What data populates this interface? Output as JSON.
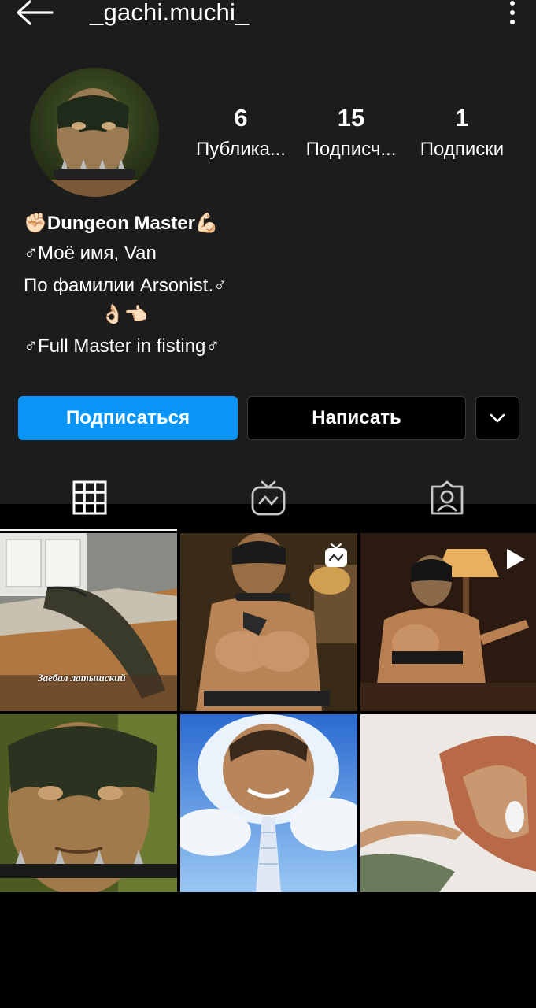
{
  "header": {
    "username": "_gachi.muchi_",
    "back_icon": "arrow-left-icon",
    "more_icon": "vertical-dots-icon"
  },
  "profile": {
    "avatar_icon": "avatar-photo",
    "stats": [
      {
        "value": "6",
        "label": "Публика..."
      },
      {
        "value": "15",
        "label": "Подписч..."
      },
      {
        "value": "1",
        "label": "Подписки"
      }
    ],
    "bio": {
      "name_emoji_left": "✊🏻",
      "name": "Dungeon Master",
      "name_emoji_right": "💪🏻",
      "line1": "♂Моё имя, Van",
      "line2": "По фамилии Arsonist.♂",
      "line3": "👌🏻👈🏻",
      "line4": "♂Full Master in fisting♂"
    }
  },
  "actions": {
    "follow_label": "Подписаться",
    "message_label": "Написать",
    "dropdown_icon": "chevron-down-icon"
  },
  "tabs": [
    {
      "icon": "grid-icon",
      "active": true
    },
    {
      "icon": "igtv-icon",
      "active": false
    },
    {
      "icon": "tagged-icon",
      "active": false
    }
  ],
  "posts": [
    {
      "caption": "Заебал латышский",
      "badge": ""
    },
    {
      "caption": "",
      "badge": "igtv-icon"
    },
    {
      "caption": "",
      "badge": "play-icon"
    },
    {
      "caption": "",
      "badge": ""
    },
    {
      "caption": "",
      "badge": ""
    },
    {
      "caption": "",
      "badge": ""
    }
  ],
  "colors": {
    "header_bg": "#1c1c1c",
    "page_bg": "#000000",
    "accent": "#0a95f6",
    "text": "#ffffff"
  }
}
